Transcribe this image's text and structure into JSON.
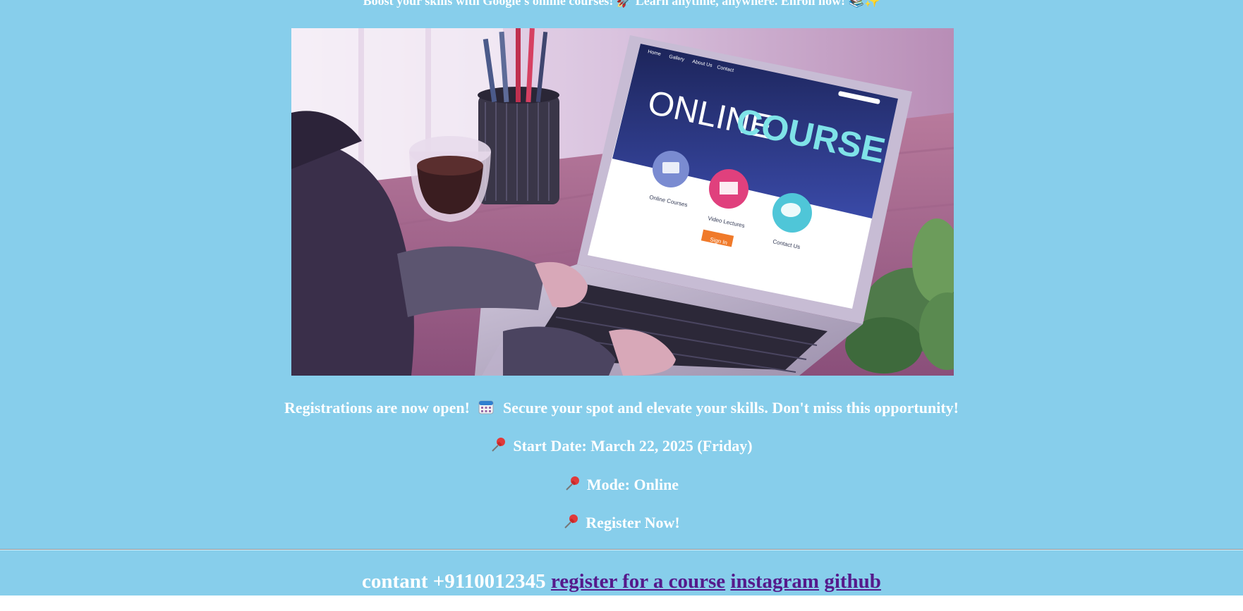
{
  "header": {
    "tagline": "Boost your skills with Google's online courses! 🚀 Learn anytime, anywhere. Enroll now! 📚✨"
  },
  "hero": {
    "screen_title_1": "ONLINE",
    "screen_title_2": "COURSE",
    "nav": [
      "Home",
      "Gallery",
      "About Us",
      "Contact"
    ],
    "features": [
      "Online Courses",
      "Video Lectures",
      "Contact Us"
    ],
    "signin_label": "Sign In"
  },
  "info": {
    "registration_prefix": "Registrations are now open!",
    "registration_suffix": "Secure your spot and elevate your skills. Don't miss this opportunity!",
    "start_date": "Start Date: March 22, 2025 (Friday)",
    "mode": "Mode: Online",
    "register": "Register Now!"
  },
  "footer": {
    "contact": "contant +9110012345",
    "register_link": "register for a course",
    "instagram_link": "instagram",
    "github_link": "github"
  },
  "colors": {
    "page_background": "#87ceeb",
    "text": "#ffffff",
    "link": "#551a8b"
  }
}
